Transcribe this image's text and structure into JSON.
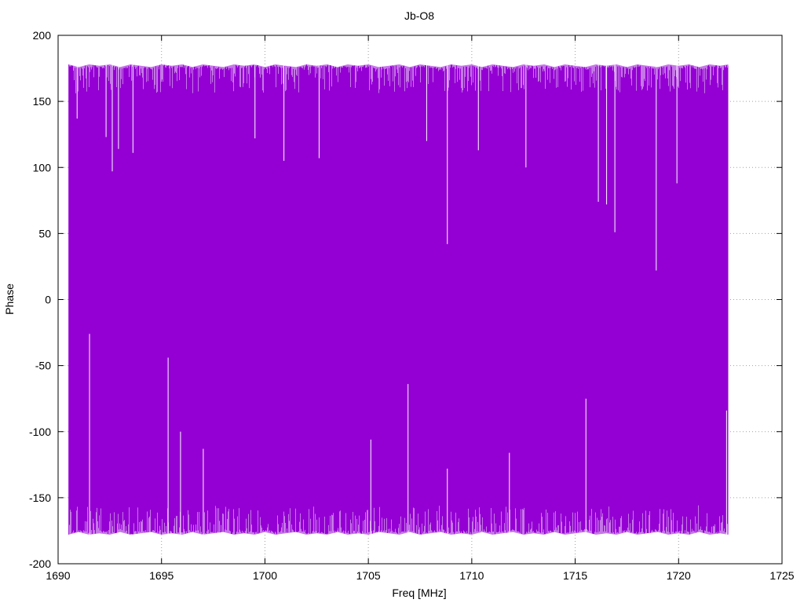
{
  "chart_data": {
    "type": "line",
    "title": "Jb-O8",
    "xlabel": "Freq [MHz]",
    "ylabel": "Phase",
    "xlim": [
      1690,
      1725
    ],
    "ylim": [
      -200,
      200
    ],
    "xticks": [
      1690,
      1695,
      1700,
      1705,
      1710,
      1715,
      1720,
      1725
    ],
    "yticks": [
      -200,
      -150,
      -100,
      -50,
      0,
      50,
      100,
      150,
      200
    ],
    "grid": true,
    "legend": "none",
    "series": [
      {
        "color": "#9400d3",
        "x_range": [
          1690.5,
          1722.4
        ],
        "envelope_upper": [
          [
            1690.5,
            178
          ],
          [
            1691.0,
            176
          ],
          [
            1691.5,
            178
          ],
          [
            1692.0,
            177
          ],
          [
            1692.5,
            178
          ],
          [
            1693.0,
            176
          ],
          [
            1693.5,
            178
          ],
          [
            1694.0,
            177
          ],
          [
            1694.5,
            176
          ],
          [
            1695.0,
            178
          ],
          [
            1695.5,
            177
          ],
          [
            1696.0,
            178
          ],
          [
            1696.5,
            176
          ],
          [
            1697.0,
            178
          ],
          [
            1697.5,
            177
          ],
          [
            1698.0,
            176
          ],
          [
            1698.5,
            178
          ],
          [
            1699.0,
            177
          ],
          [
            1699.5,
            178
          ],
          [
            1700.0,
            176
          ],
          [
            1700.5,
            178
          ],
          [
            1701.0,
            177
          ],
          [
            1701.5,
            176
          ],
          [
            1702.0,
            178
          ],
          [
            1702.5,
            177
          ],
          [
            1703.0,
            178
          ],
          [
            1703.5,
            176
          ],
          [
            1704.0,
            178
          ],
          [
            1704.5,
            177
          ],
          [
            1705.0,
            178
          ],
          [
            1705.5,
            176
          ],
          [
            1706.0,
            177
          ],
          [
            1706.5,
            178
          ],
          [
            1707.0,
            176
          ],
          [
            1707.5,
            178
          ],
          [
            1708.0,
            177
          ],
          [
            1708.5,
            176
          ],
          [
            1709.0,
            178
          ],
          [
            1709.5,
            177
          ],
          [
            1710.0,
            178
          ],
          [
            1710.5,
            176
          ],
          [
            1711.0,
            178
          ],
          [
            1711.5,
            177
          ],
          [
            1712.0,
            176
          ],
          [
            1712.5,
            178
          ],
          [
            1713.0,
            177
          ],
          [
            1713.5,
            178
          ],
          [
            1714.0,
            176
          ],
          [
            1714.5,
            178
          ],
          [
            1715.0,
            177
          ],
          [
            1715.5,
            176
          ],
          [
            1716.0,
            178
          ],
          [
            1716.5,
            177
          ],
          [
            1717.0,
            178
          ],
          [
            1717.5,
            176
          ],
          [
            1718.0,
            178
          ],
          [
            1718.5,
            177
          ],
          [
            1719.0,
            176
          ],
          [
            1719.5,
            178
          ],
          [
            1720.0,
            177
          ],
          [
            1720.5,
            178
          ],
          [
            1721.0,
            176
          ],
          [
            1721.5,
            178
          ],
          [
            1722.0,
            177
          ],
          [
            1722.4,
            178
          ]
        ],
        "envelope_lower": [
          [
            1690.5,
            -178
          ],
          [
            1691.0,
            -176
          ],
          [
            1691.5,
            -178
          ],
          [
            1692.0,
            -177
          ],
          [
            1692.5,
            -178
          ],
          [
            1693.0,
            -176
          ],
          [
            1693.5,
            -178
          ],
          [
            1694.0,
            -177
          ],
          [
            1694.5,
            -176
          ],
          [
            1695.0,
            -178
          ],
          [
            1695.5,
            -177
          ],
          [
            1696.0,
            -178
          ],
          [
            1696.5,
            -176
          ],
          [
            1697.0,
            -178
          ],
          [
            1697.5,
            -177
          ],
          [
            1698.0,
            -176
          ],
          [
            1698.5,
            -178
          ],
          [
            1699.0,
            -177
          ],
          [
            1699.5,
            -178
          ],
          [
            1700.0,
            -176
          ],
          [
            1700.5,
            -178
          ],
          [
            1701.0,
            -177
          ],
          [
            1701.5,
            -176
          ],
          [
            1702.0,
            -178
          ],
          [
            1702.5,
            -177
          ],
          [
            1703.0,
            -178
          ],
          [
            1703.5,
            -176
          ],
          [
            1704.0,
            -178
          ],
          [
            1704.5,
            -177
          ],
          [
            1705.0,
            -178
          ],
          [
            1705.5,
            -176
          ],
          [
            1706.0,
            -177
          ],
          [
            1706.5,
            -178
          ],
          [
            1707.0,
            -176
          ],
          [
            1707.5,
            -178
          ],
          [
            1708.0,
            -177
          ],
          [
            1708.5,
            -176
          ],
          [
            1709.0,
            -178
          ],
          [
            1709.5,
            -177
          ],
          [
            1710.0,
            -178
          ],
          [
            1710.5,
            -176
          ],
          [
            1711.0,
            -178
          ],
          [
            1711.5,
            -177
          ],
          [
            1712.0,
            -176
          ],
          [
            1712.5,
            -178
          ],
          [
            1713.0,
            -177
          ],
          [
            1713.5,
            -178
          ],
          [
            1714.0,
            -176
          ],
          [
            1714.5,
            -178
          ],
          [
            1715.0,
            -177
          ],
          [
            1715.5,
            -176
          ],
          [
            1716.0,
            -178
          ],
          [
            1716.5,
            -177
          ],
          [
            1717.0,
            -178
          ],
          [
            1717.5,
            -176
          ],
          [
            1718.0,
            -178
          ],
          [
            1718.5,
            -177
          ],
          [
            1719.0,
            -176
          ],
          [
            1719.5,
            -178
          ],
          [
            1720.0,
            -177
          ],
          [
            1720.5,
            -178
          ],
          [
            1721.0,
            -176
          ],
          [
            1721.5,
            -178
          ],
          [
            1722.0,
            -177
          ],
          [
            1722.4,
            -178
          ]
        ],
        "top_dips": [
          [
            1690.9,
            137
          ],
          [
            1692.3,
            123
          ],
          [
            1692.6,
            97
          ],
          [
            1692.9,
            114
          ],
          [
            1693.6,
            111
          ],
          [
            1699.5,
            122
          ],
          [
            1700.9,
            105
          ],
          [
            1702.6,
            107
          ],
          [
            1707.8,
            120
          ],
          [
            1708.8,
            42
          ],
          [
            1710.3,
            113
          ],
          [
            1712.6,
            100
          ],
          [
            1716.1,
            74
          ],
          [
            1716.5,
            72
          ],
          [
            1716.9,
            51
          ],
          [
            1718.9,
            22
          ],
          [
            1719.9,
            88
          ]
        ],
        "bottom_spikes": [
          [
            1691.5,
            -26
          ],
          [
            1695.3,
            -44
          ],
          [
            1695.9,
            -100
          ],
          [
            1697.0,
            -113
          ],
          [
            1705.1,
            -106
          ],
          [
            1706.9,
            -64
          ],
          [
            1708.8,
            -128
          ],
          [
            1711.8,
            -116
          ],
          [
            1715.5,
            -75
          ],
          [
            1722.3,
            -84
          ]
        ]
      }
    ]
  }
}
